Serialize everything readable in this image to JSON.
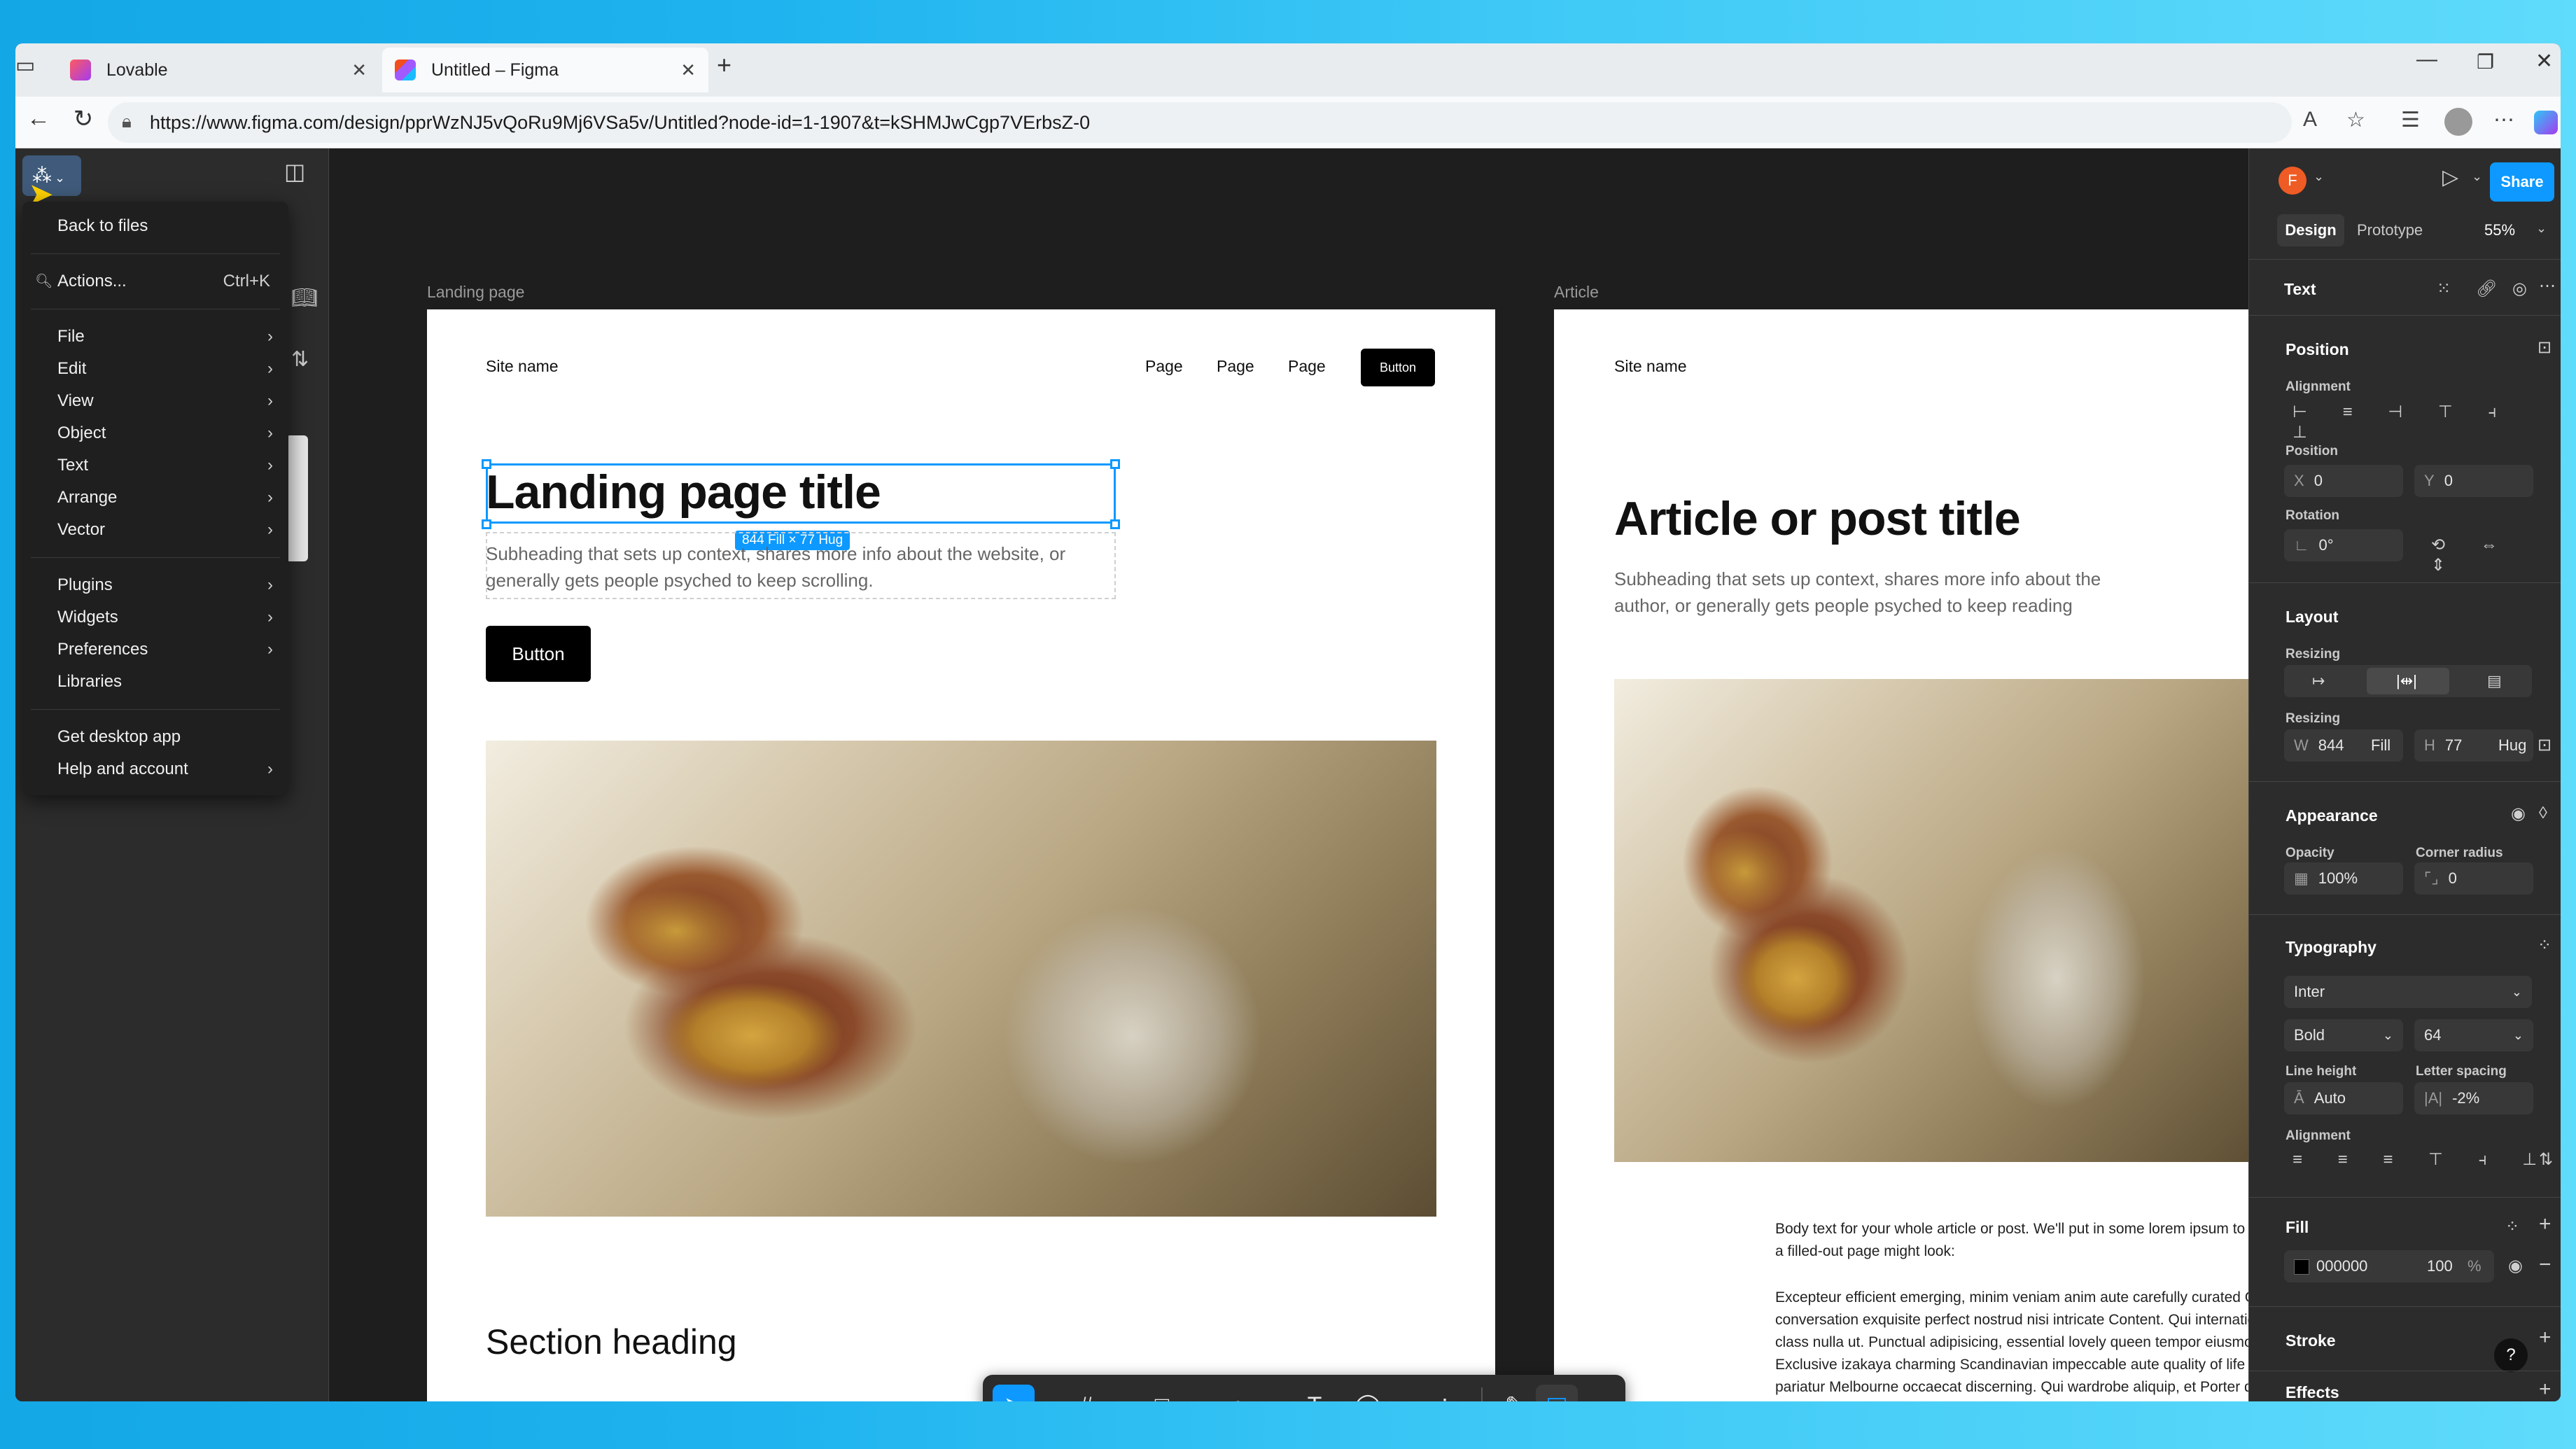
{
  "browser": {
    "tabs": [
      {
        "title": "Lovable",
        "active": false
      },
      {
        "title": "Untitled – Figma",
        "active": true
      }
    ],
    "url": "https://www.figma.com/design/pprWzNJ5vQoRu9Mj6VSa5v/Untitled?node-id=1-1907&t=kSHMJwCgp7VErbsZ-0"
  },
  "main_menu": {
    "items": [
      {
        "label": "Back to files"
      },
      {
        "label": "Actions...",
        "shortcut": "Ctrl+K"
      },
      {
        "label": "File"
      },
      {
        "label": "Edit"
      },
      {
        "label": "View"
      },
      {
        "label": "Object"
      },
      {
        "label": "Text"
      },
      {
        "label": "Arrange"
      },
      {
        "label": "Vector"
      },
      {
        "label": "Plugins"
      },
      {
        "label": "Widgets"
      },
      {
        "label": "Preferences"
      },
      {
        "label": "Libraries"
      },
      {
        "label": "Get desktop app"
      },
      {
        "label": "Help and account"
      }
    ]
  },
  "canvas": {
    "landing": {
      "frame_label": "Landing page",
      "site_name": "Site name",
      "nav": [
        "Page",
        "Page",
        "Page"
      ],
      "nav_button": "Button",
      "title": "Landing page title",
      "selection_badge": "844 Fill × 77 Hug",
      "subheading": "Subheading that sets up context, shares more info about the website, or generally gets people psyched to keep scrolling.",
      "button": "Button",
      "section_heading": "Section heading"
    },
    "article": {
      "frame_label": "Article",
      "site_name": "Site name",
      "title": "Article or post title",
      "subheading": "Subheading that sets up context, shares more info about the author, or generally gets people psyched to keep reading",
      "body1": "Body text for your whole article or post. We'll put in some lorem ipsum to show how a filled-out page might look:",
      "body2": "Excepteur efficient emerging, minim veniam anim aute carefully curated Ginza conversation exquisite perfect nostrud nisi intricate Content. Qui international first-class nulla ut. Punctual adipisicing, essential lovely queen tempor eiusmod irure. Exclusive izakaya charming Scandinavian impeccable aute quality of life soft power pariatur Melbourne occaecat discerning. Qui wardrobe aliquip, et Porter destination"
    }
  },
  "right_panel": {
    "avatar_letter": "F",
    "share": "Share",
    "tabs": [
      "Design",
      "Prototype"
    ],
    "zoom": "55%",
    "section_text": "Text",
    "position": {
      "title": "Position",
      "alignment_label": "Alignment",
      "position_label": "Position",
      "x": "0",
      "y": "0",
      "rotation_label": "Rotation",
      "rotation": "0°"
    },
    "layout": {
      "title": "Layout",
      "resizing_label": "Resizing",
      "resizing_label2": "Resizing",
      "w": "844",
      "w_mode": "Fill",
      "h": "77",
      "h_mode": "Hug"
    },
    "appearance": {
      "title": "Appearance",
      "opacity_label": "Opacity",
      "opacity": "100%",
      "radius_label": "Corner radius",
      "radius": "0"
    },
    "typography": {
      "title": "Typography",
      "font": "Inter",
      "weight": "Bold",
      "size": "64",
      "line_height_label": "Line height",
      "line_height": "Auto",
      "letter_spacing_label": "Letter spacing",
      "letter_spacing": "-2%",
      "alignment_label": "Alignment"
    },
    "fill": {
      "title": "Fill",
      "hex": "000000",
      "opacity": "100",
      "pct": "%"
    },
    "stroke": {
      "title": "Stroke"
    },
    "effects": {
      "title": "Effects"
    }
  },
  "colors": {
    "accent": "#0d99ff",
    "selection": "#0d99ff"
  }
}
